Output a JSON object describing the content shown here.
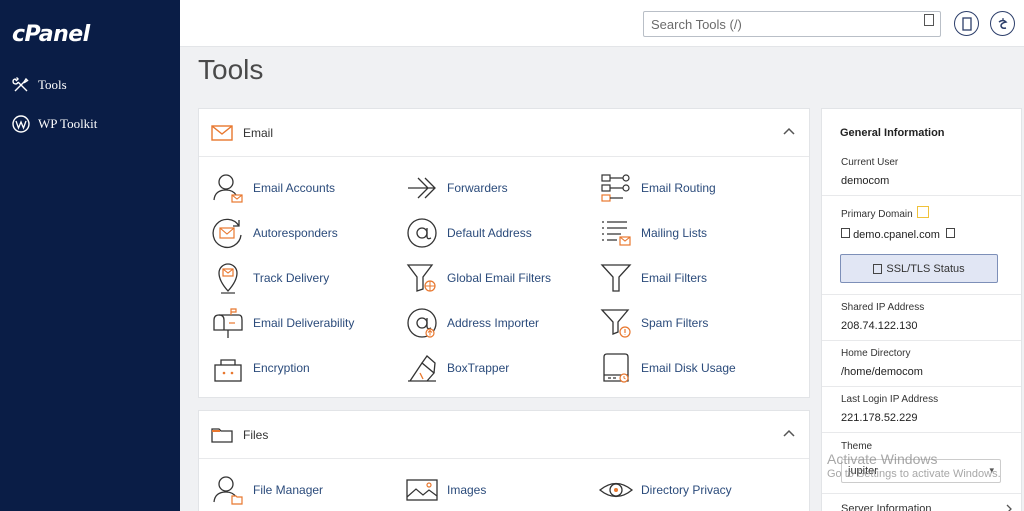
{
  "sidebar": {
    "logo": "cPanel",
    "items": [
      {
        "label": "Tools",
        "icon": "tools-icon"
      },
      {
        "label": "WP Toolkit",
        "icon": "wordpress-icon"
      }
    ]
  },
  "topbar": {
    "search_placeholder": "Search Tools (/)"
  },
  "page": {
    "title": "Tools"
  },
  "email": {
    "title": "Email",
    "tools": [
      {
        "label": "Email Accounts",
        "icon": "email-accounts-icon"
      },
      {
        "label": "Forwarders",
        "icon": "forwarders-icon"
      },
      {
        "label": "Email Routing",
        "icon": "email-routing-icon"
      },
      {
        "label": "Autoresponders",
        "icon": "autoresponders-icon"
      },
      {
        "label": "Default Address",
        "icon": "default-address-icon"
      },
      {
        "label": "Mailing Lists",
        "icon": "mailing-lists-icon"
      },
      {
        "label": "Track Delivery",
        "icon": "track-delivery-icon"
      },
      {
        "label": "Global Email Filters",
        "icon": "global-email-filters-icon"
      },
      {
        "label": "Email Filters",
        "icon": "email-filters-icon"
      },
      {
        "label": "Email Deliverability",
        "icon": "email-deliverability-icon"
      },
      {
        "label": "Address Importer",
        "icon": "address-importer-icon"
      },
      {
        "label": "Spam Filters",
        "icon": "spam-filters-icon"
      },
      {
        "label": "Encryption",
        "icon": "encryption-icon"
      },
      {
        "label": "BoxTrapper",
        "icon": "boxtrapper-icon"
      },
      {
        "label": "Email Disk Usage",
        "icon": "email-disk-usage-icon"
      }
    ]
  },
  "files": {
    "title": "Files",
    "tools": [
      {
        "label": "File Manager",
        "icon": "file-manager-icon"
      },
      {
        "label": "Images",
        "icon": "images-icon"
      },
      {
        "label": "Directory Privacy",
        "icon": "directory-privacy-icon"
      }
    ]
  },
  "general_info": {
    "title": "General Information",
    "current_user_label": "Current User",
    "current_user": "democom",
    "primary_domain_label": "Primary Domain",
    "primary_domain": "demo.cpanel.com",
    "ssl_button": "SSL/TLS Status",
    "shared_ip_label": "Shared IP Address",
    "shared_ip": "208.74.122.130",
    "home_dir_label": "Home Directory",
    "home_dir": "/home/democom",
    "last_login_label": "Last Login IP Address",
    "last_login": "221.178.52.229",
    "theme_label": "Theme",
    "theme": "jupiter",
    "server_info": "Server Information"
  },
  "watermark": {
    "line1": "Activate Windows",
    "line2": "Go to Settings to activate Windows."
  },
  "colors": {
    "sidebar_bg": "#0a1d46",
    "accent_orange": "#e8772e",
    "link_blue": "#2b4b7b"
  }
}
